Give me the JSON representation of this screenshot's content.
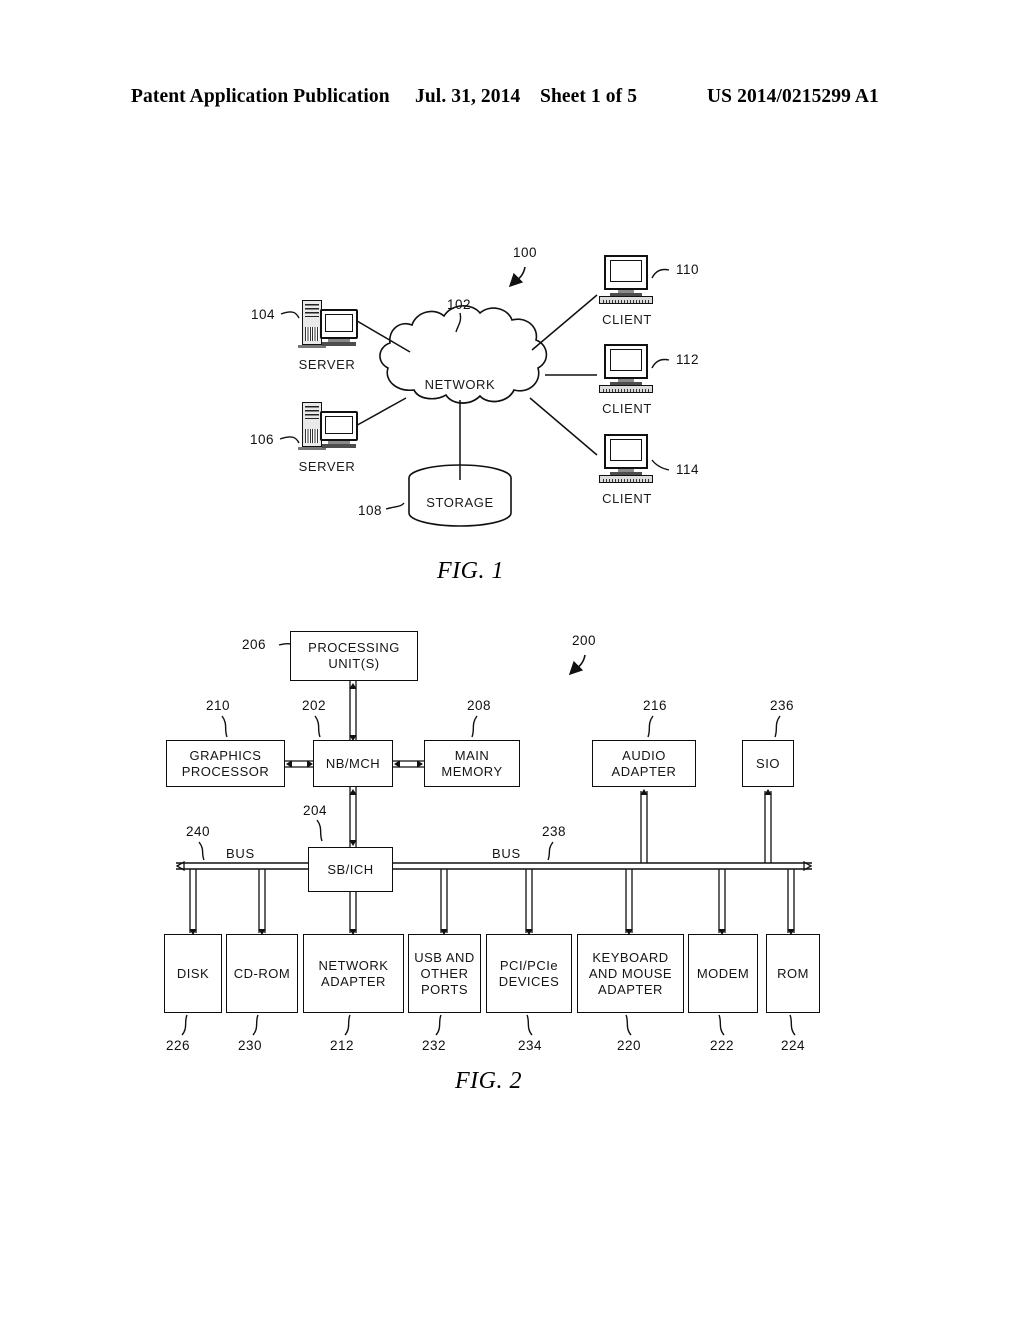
{
  "header": {
    "title": "Patent Application Publication",
    "date": "Jul. 31, 2014",
    "sheet": "Sheet 1 of 5",
    "publication_number": "US 2014/0215299 A1"
  },
  "figure1": {
    "caption": "FIG. 1",
    "system_ref": "100",
    "nodes": [
      {
        "id": "server1",
        "label": "SERVER",
        "ref": "104"
      },
      {
        "id": "server2",
        "label": "SERVER",
        "ref": "106"
      },
      {
        "id": "network",
        "label": "NETWORK",
        "ref": "102"
      },
      {
        "id": "storage",
        "label": "STORAGE",
        "ref": "108"
      },
      {
        "id": "client1",
        "label": "CLIENT",
        "ref": "110"
      },
      {
        "id": "client2",
        "label": "CLIENT",
        "ref": "112"
      },
      {
        "id": "client3",
        "label": "CLIENT",
        "ref": "114"
      }
    ]
  },
  "figure2": {
    "caption": "FIG. 2",
    "system_ref": "200",
    "bus_left_label": "BUS",
    "bus_right_label": "BUS",
    "bus_left_ref": "240",
    "bus_right_ref": "238",
    "blocks": [
      {
        "id": "processing_unit",
        "label": "PROCESSING\nUNIT(S)",
        "ref": "206"
      },
      {
        "id": "graphics_processor",
        "label": "GRAPHICS\nPROCESSOR",
        "ref": "210"
      },
      {
        "id": "nb_mch",
        "label": "NB/MCH",
        "ref": "202"
      },
      {
        "id": "main_memory",
        "label": "MAIN\nMEMORY",
        "ref": "208"
      },
      {
        "id": "audio_adapter",
        "label": "AUDIO\nADAPTER",
        "ref": "216"
      },
      {
        "id": "sio",
        "label": "SIO",
        "ref": "236"
      },
      {
        "id": "sb_ich",
        "label": "SB/ICH",
        "ref": "204"
      },
      {
        "id": "disk",
        "label": "DISK",
        "ref": "226"
      },
      {
        "id": "cdrom",
        "label": "CD-ROM",
        "ref": "230"
      },
      {
        "id": "network_adapter",
        "label": "NETWORK\nADAPTER",
        "ref": "212"
      },
      {
        "id": "usb_ports",
        "label": "USB AND\nOTHER\nPORTS",
        "ref": "232"
      },
      {
        "id": "pci_devices",
        "label": "PCI/PCIe\nDEVICES",
        "ref": "234"
      },
      {
        "id": "keyboard_mouse_adapter",
        "label": "KEYBOARD\nAND MOUSE\nADAPTER",
        "ref": "220"
      },
      {
        "id": "modem",
        "label": "MODEM",
        "ref": "222"
      },
      {
        "id": "rom",
        "label": "ROM",
        "ref": "224"
      }
    ]
  },
  "colors": {
    "ink": "#000000",
    "paper": "#ffffff"
  }
}
